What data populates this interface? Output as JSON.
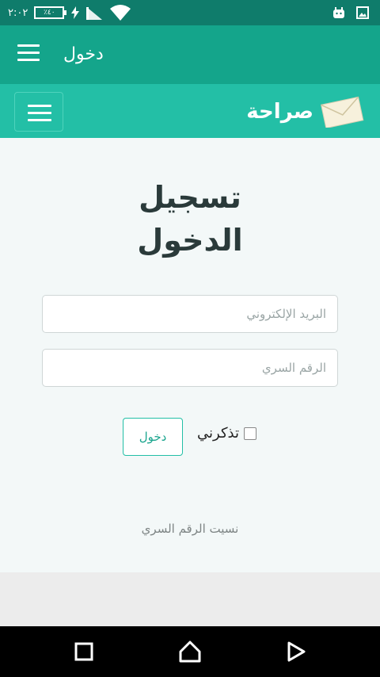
{
  "status_bar": {
    "time": "٢:٠٢",
    "battery": "٪٤٠"
  },
  "app_bar": {
    "title": "دخول"
  },
  "site": {
    "brand": "صراحة"
  },
  "login": {
    "heading_line1": "تسجيل",
    "heading_line2": "الدخول",
    "email_placeholder": "البريد الإلكتروني",
    "password_placeholder": "الرقم السري",
    "remember_label": "تذكرني",
    "submit_label": "دخول",
    "forgot_link": "نسيت الرقم السري"
  },
  "colors": {
    "status_bar": "#0f7c6b",
    "app_bar": "#14a58b",
    "site_nav": "#23bfa6",
    "background": "#f3f8f8"
  },
  "icons": [
    "wifi-icon",
    "signal-icon",
    "battery-icon",
    "android-icon",
    "image-icon",
    "hamburger-menu-icon",
    "envelope-logo-icon",
    "back-icon",
    "home-icon",
    "recents-icon"
  ]
}
